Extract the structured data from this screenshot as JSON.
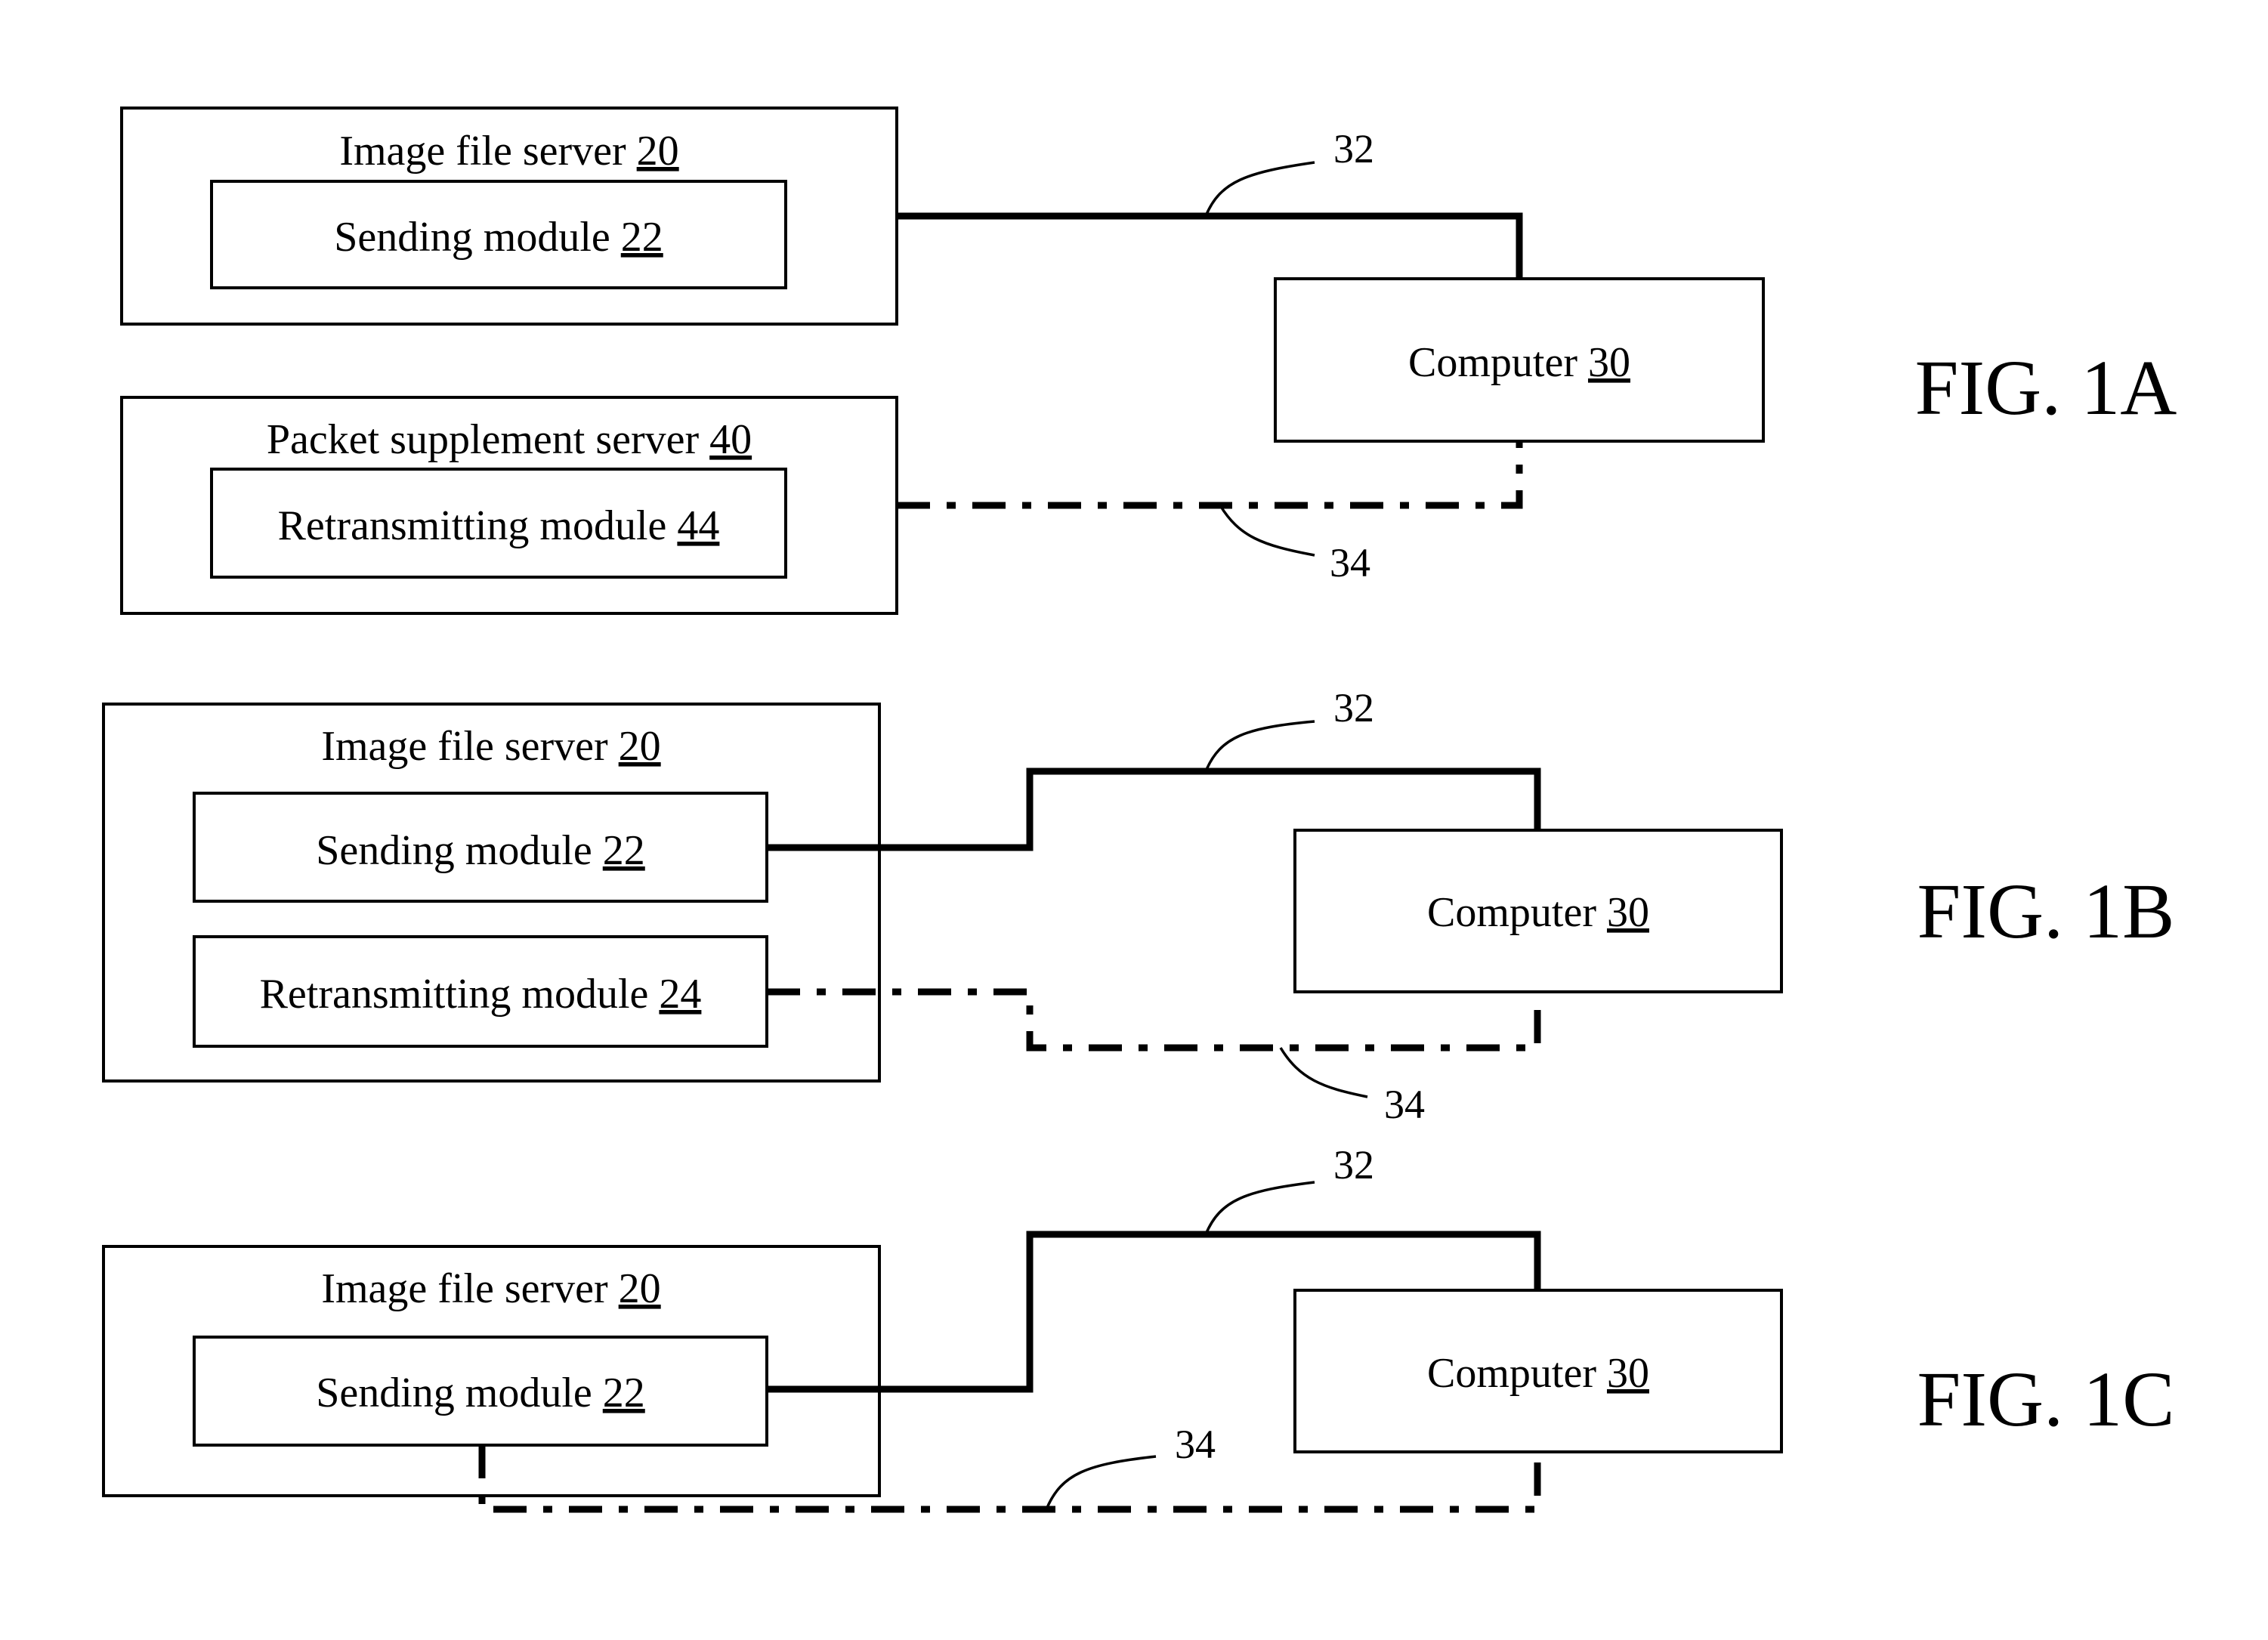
{
  "figures": [
    {
      "id": "1A",
      "caption": "FIG. 1A",
      "boxes": {
        "server": {
          "label": "Image file server",
          "num": "20"
        },
        "module1": {
          "label": "Sending module",
          "num": "22"
        },
        "server2": {
          "label": "Packet supplement server",
          "num": "40"
        },
        "module2": {
          "label": "Retransmitting module",
          "num": "44"
        },
        "computer": {
          "label": "Computer",
          "num": "30"
        }
      },
      "refs": {
        "solid": "32",
        "dash": "34"
      }
    },
    {
      "id": "1B",
      "caption": "FIG. 1B",
      "boxes": {
        "server": {
          "label": "Image file server",
          "num": "20"
        },
        "module1": {
          "label": "Sending module",
          "num": "22"
        },
        "module2": {
          "label": "Retransmitting module",
          "num": "24"
        },
        "computer": {
          "label": "Computer",
          "num": "30"
        }
      },
      "refs": {
        "solid": "32",
        "dash": "34"
      }
    },
    {
      "id": "1C",
      "caption": "FIG. 1C",
      "boxes": {
        "server": {
          "label": "Image file server",
          "num": "20"
        },
        "module1": {
          "label": "Sending module",
          "num": "22"
        },
        "computer": {
          "label": "Computer",
          "num": "30"
        }
      },
      "refs": {
        "solid": "32",
        "dash": "34"
      }
    }
  ]
}
